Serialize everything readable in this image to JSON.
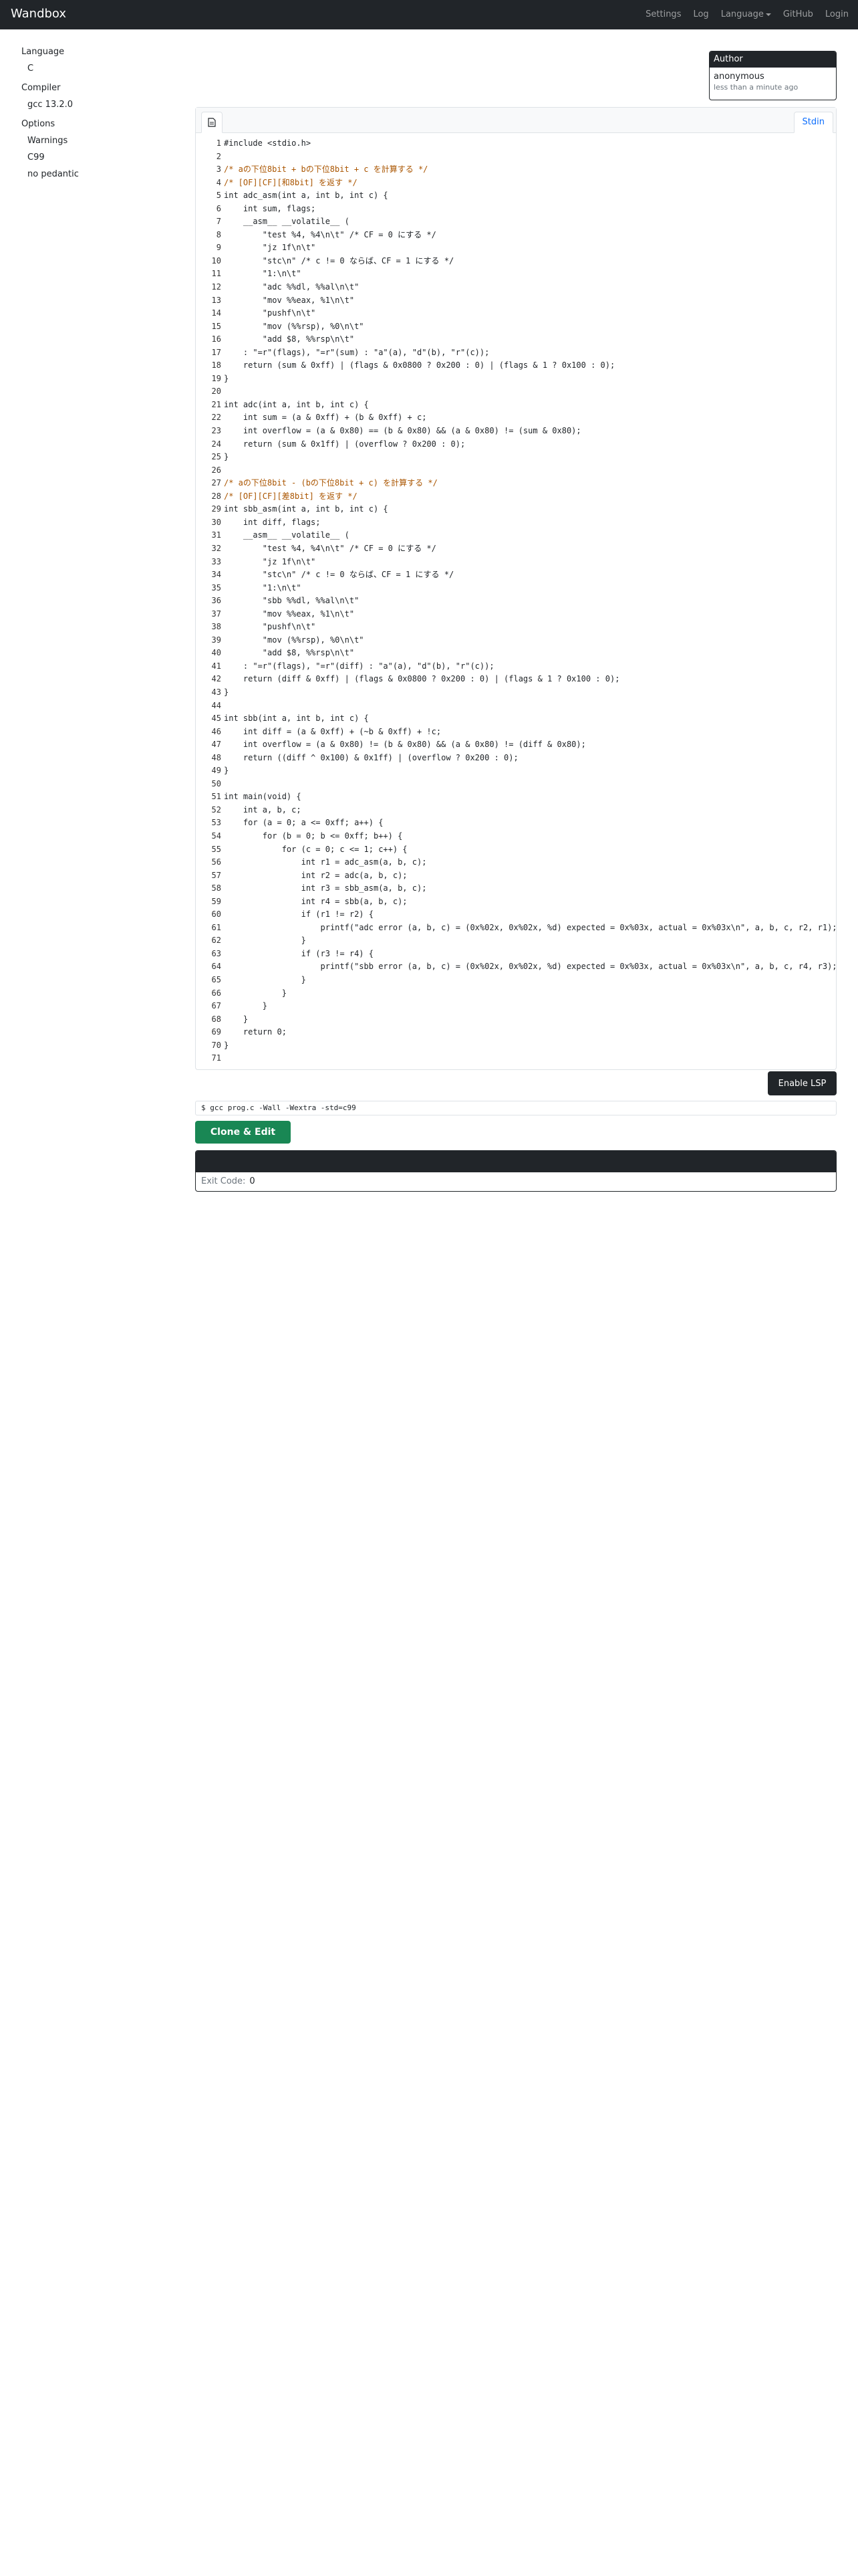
{
  "navbar": {
    "brand": "Wandbox",
    "links": [
      "Settings",
      "Log",
      "Language",
      "GitHub",
      "Login"
    ]
  },
  "sidebar": {
    "language_label": "Language",
    "language_value": "C",
    "compiler_label": "Compiler",
    "compiler_value": "gcc 13.2.0",
    "options_label": "Options",
    "options": [
      "Warnings",
      "C99",
      "no pedantic"
    ]
  },
  "author": {
    "heading": "Author",
    "name": "anonymous",
    "time": "less than a minute ago"
  },
  "editor": {
    "stdin_tab": "Stdin",
    "file_tab_icon": "file-icon",
    "code_lines": [
      "#include <stdio.h>",
      "",
      "/* aの下位8bit + bの下位8bit + c を計算する */",
      "/* [OF][CF][和8bit] を返す */",
      "int adc_asm(int a, int b, int c) {",
      "    int sum, flags;",
      "    __asm__ __volatile__ (",
      "        \"test %4, %4\\n\\t\" /* CF = 0 にする */",
      "        \"jz 1f\\n\\t\"",
      "        \"stc\\n\" /* c != 0 ならば、CF = 1 にする */",
      "        \"1:\\n\\t\"",
      "        \"adc %%dl, %%al\\n\\t\"",
      "        \"mov %%eax, %1\\n\\t\"",
      "        \"pushf\\n\\t\"",
      "        \"mov (%%rsp), %0\\n\\t\"",
      "        \"add $8, %%rsp\\n\\t\"",
      "    : \"=r\"(flags), \"=r\"(sum) : \"a\"(a), \"d\"(b), \"r\"(c));",
      "    return (sum & 0xff) | (flags & 0x0800 ? 0x200 : 0) | (flags & 1 ? 0x100 : 0);",
      "}",
      "",
      "int adc(int a, int b, int c) {",
      "    int sum = (a & 0xff) + (b & 0xff) + c;",
      "    int overflow = (a & 0x80) == (b & 0x80) && (a & 0x80) != (sum & 0x80);",
      "    return (sum & 0x1ff) | (overflow ? 0x200 : 0);",
      "}",
      "",
      "/* aの下位8bit - (bの下位8bit + c) を計算する */",
      "/* [OF][CF][差8bit] を返す */",
      "int sbb_asm(int a, int b, int c) {",
      "    int diff, flags;",
      "    __asm__ __volatile__ (",
      "        \"test %4, %4\\n\\t\" /* CF = 0 にする */",
      "        \"jz 1f\\n\\t\"",
      "        \"stc\\n\" /* c != 0 ならば、CF = 1 にする */",
      "        \"1:\\n\\t\"",
      "        \"sbb %%dl, %%al\\n\\t\"",
      "        \"mov %%eax, %1\\n\\t\"",
      "        \"pushf\\n\\t\"",
      "        \"mov (%%rsp), %0\\n\\t\"",
      "        \"add $8, %%rsp\\n\\t\"",
      "    : \"=r\"(flags), \"=r\"(diff) : \"a\"(a), \"d\"(b), \"r\"(c));",
      "    return (diff & 0xff) | (flags & 0x0800 ? 0x200 : 0) | (flags & 1 ? 0x100 : 0);",
      "}",
      "",
      "int sbb(int a, int b, int c) {",
      "    int diff = (a & 0xff) + (~b & 0xff) + !c;",
      "    int overflow = (a & 0x80) != (b & 0x80) && (a & 0x80) != (diff & 0x80);",
      "    return ((diff ^ 0x100) & 0x1ff) | (overflow ? 0x200 : 0);",
      "}",
      "",
      "int main(void) {",
      "    int a, b, c;",
      "    for (a = 0; a <= 0xff; a++) {",
      "        for (b = 0; b <= 0xff; b++) {",
      "            for (c = 0; c <= 1; c++) {",
      "                int r1 = adc_asm(a, b, c);",
      "                int r2 = adc(a, b, c);",
      "                int r3 = sbb_asm(a, b, c);",
      "                int r4 = sbb(a, b, c);",
      "                if (r1 != r2) {",
      "                    printf(\"adc error (a, b, c) = (0x%02x, 0x%02x, %d) expected = 0x%03x, actual = 0x%03x\\n\", a, b, c, r2, r1);",
      "                }",
      "                if (r3 != r4) {",
      "                    printf(\"sbb error (a, b, c) = (0x%02x, 0x%02x, %d) expected = 0x%03x, actual = 0x%03x\\n\", a, b, c, r4, r3);",
      "                }",
      "            }",
      "        }",
      "    }",
      "    return 0;",
      "}",
      ""
    ]
  },
  "actions": {
    "enable_lsp": "Enable LSP",
    "command": "$ gcc prog.c -Wall -Wextra -std=c99",
    "clone_edit": "Clone & Edit"
  },
  "result": {
    "exit_label": "Exit Code:",
    "exit_value": "0"
  },
  "colors": {
    "navbar_bg": "#212529",
    "clone_button": "#198754",
    "stdin_tab_text": "#0d6efd"
  }
}
